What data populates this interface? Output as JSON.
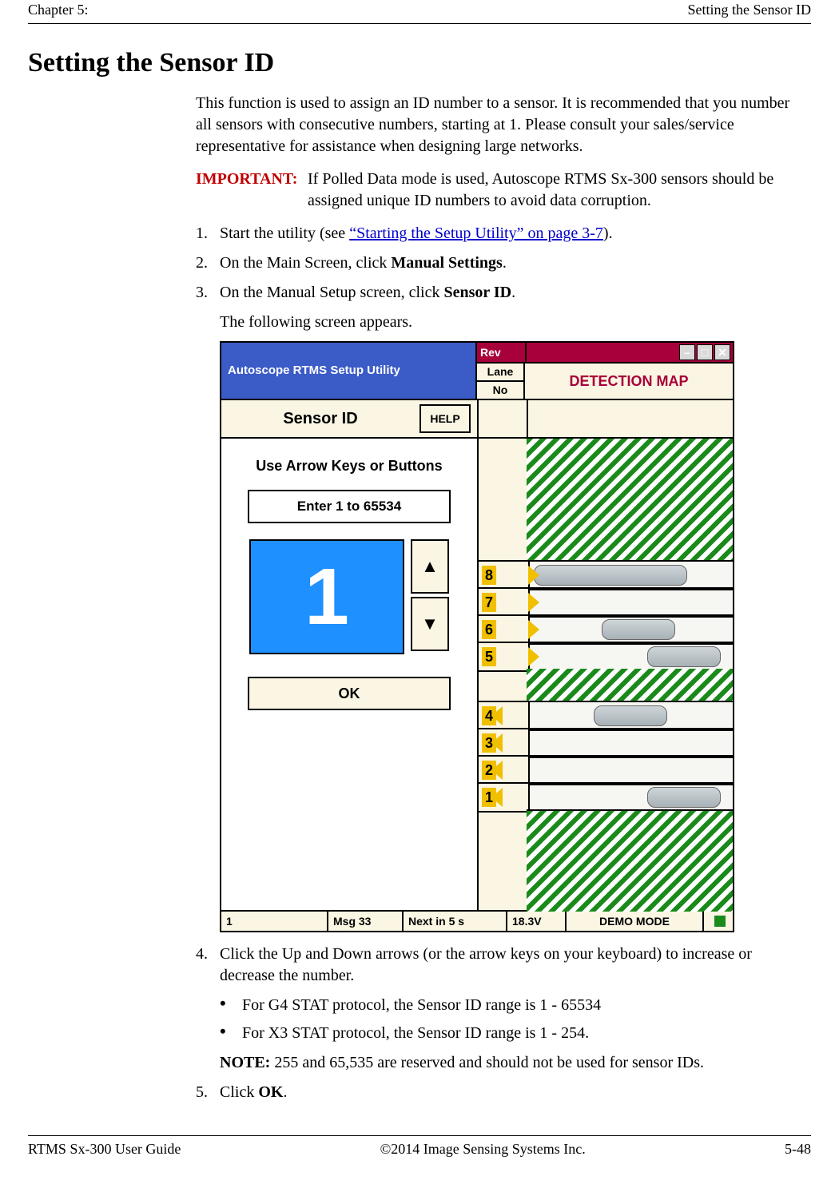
{
  "runningHead": {
    "left": "Chapter 5:",
    "right": "Setting the Sensor ID"
  },
  "heading": "Setting the Sensor ID",
  "intro": "This function is used to assign an ID number to a sensor. It is recommended that you number all sensors with consecutive numbers, starting at 1. Please consult your sales/service representative for assistance when designing large networks.",
  "important": {
    "label": "IMPORTANT:",
    "text": "If Polled Data mode is used, Autoscope RTMS Sx-300 sensors should be assigned unique ID numbers to avoid data corruption."
  },
  "steps": {
    "s1a": "Start the utility (see ",
    "s1link": "“Starting the Setup Utility” on page 3-7",
    "s1b": ").",
    "s2a": "On the Main Screen, click ",
    "s2bold": "Manual Settings",
    "s2b": ".",
    "s3a": "On the Manual Setup screen, click ",
    "s3bold": "Sensor ID",
    "s3b": ".",
    "s3sub": "The following screen appears.",
    "s4": "Click the Up and Down arrows (or the arrow keys on your keyboard) to increase or decrease the number.",
    "b1": "For G4 STAT protocol, the Sensor ID range is 1 - 65534",
    "b2": "For X3 STAT protocol, the Sensor ID range is 1 - 254.",
    "note_label": "NOTE:",
    "note_text": " 255 and 65,535 are reserved and should not be used for sensor IDs.",
    "s5a": "Click ",
    "s5bold": "OK",
    "s5b": "."
  },
  "app": {
    "title": "Autoscope RTMS Setup Utility",
    "rev": "Rev",
    "lane": "Lane",
    "no": "No",
    "detmap": "DETECTION MAP",
    "screen_label": "Sensor ID",
    "help": "HELP",
    "instruction": "Use Arrow Keys or Buttons",
    "range_hint": "Enter 1 to 65534",
    "current_value": "1",
    "ok": "OK",
    "lanes": [
      "8",
      "7",
      "6",
      "5",
      "4",
      "3",
      "2",
      "1"
    ],
    "status": {
      "id": "1",
      "msg": "Msg 33",
      "next": "Next in 5 s",
      "volt": "18.3V",
      "mode": "DEMO MODE"
    }
  },
  "footer": {
    "left": "RTMS Sx-300 User Guide",
    "center": "©2014 Image Sensing Systems Inc.",
    "right": "5-48"
  }
}
